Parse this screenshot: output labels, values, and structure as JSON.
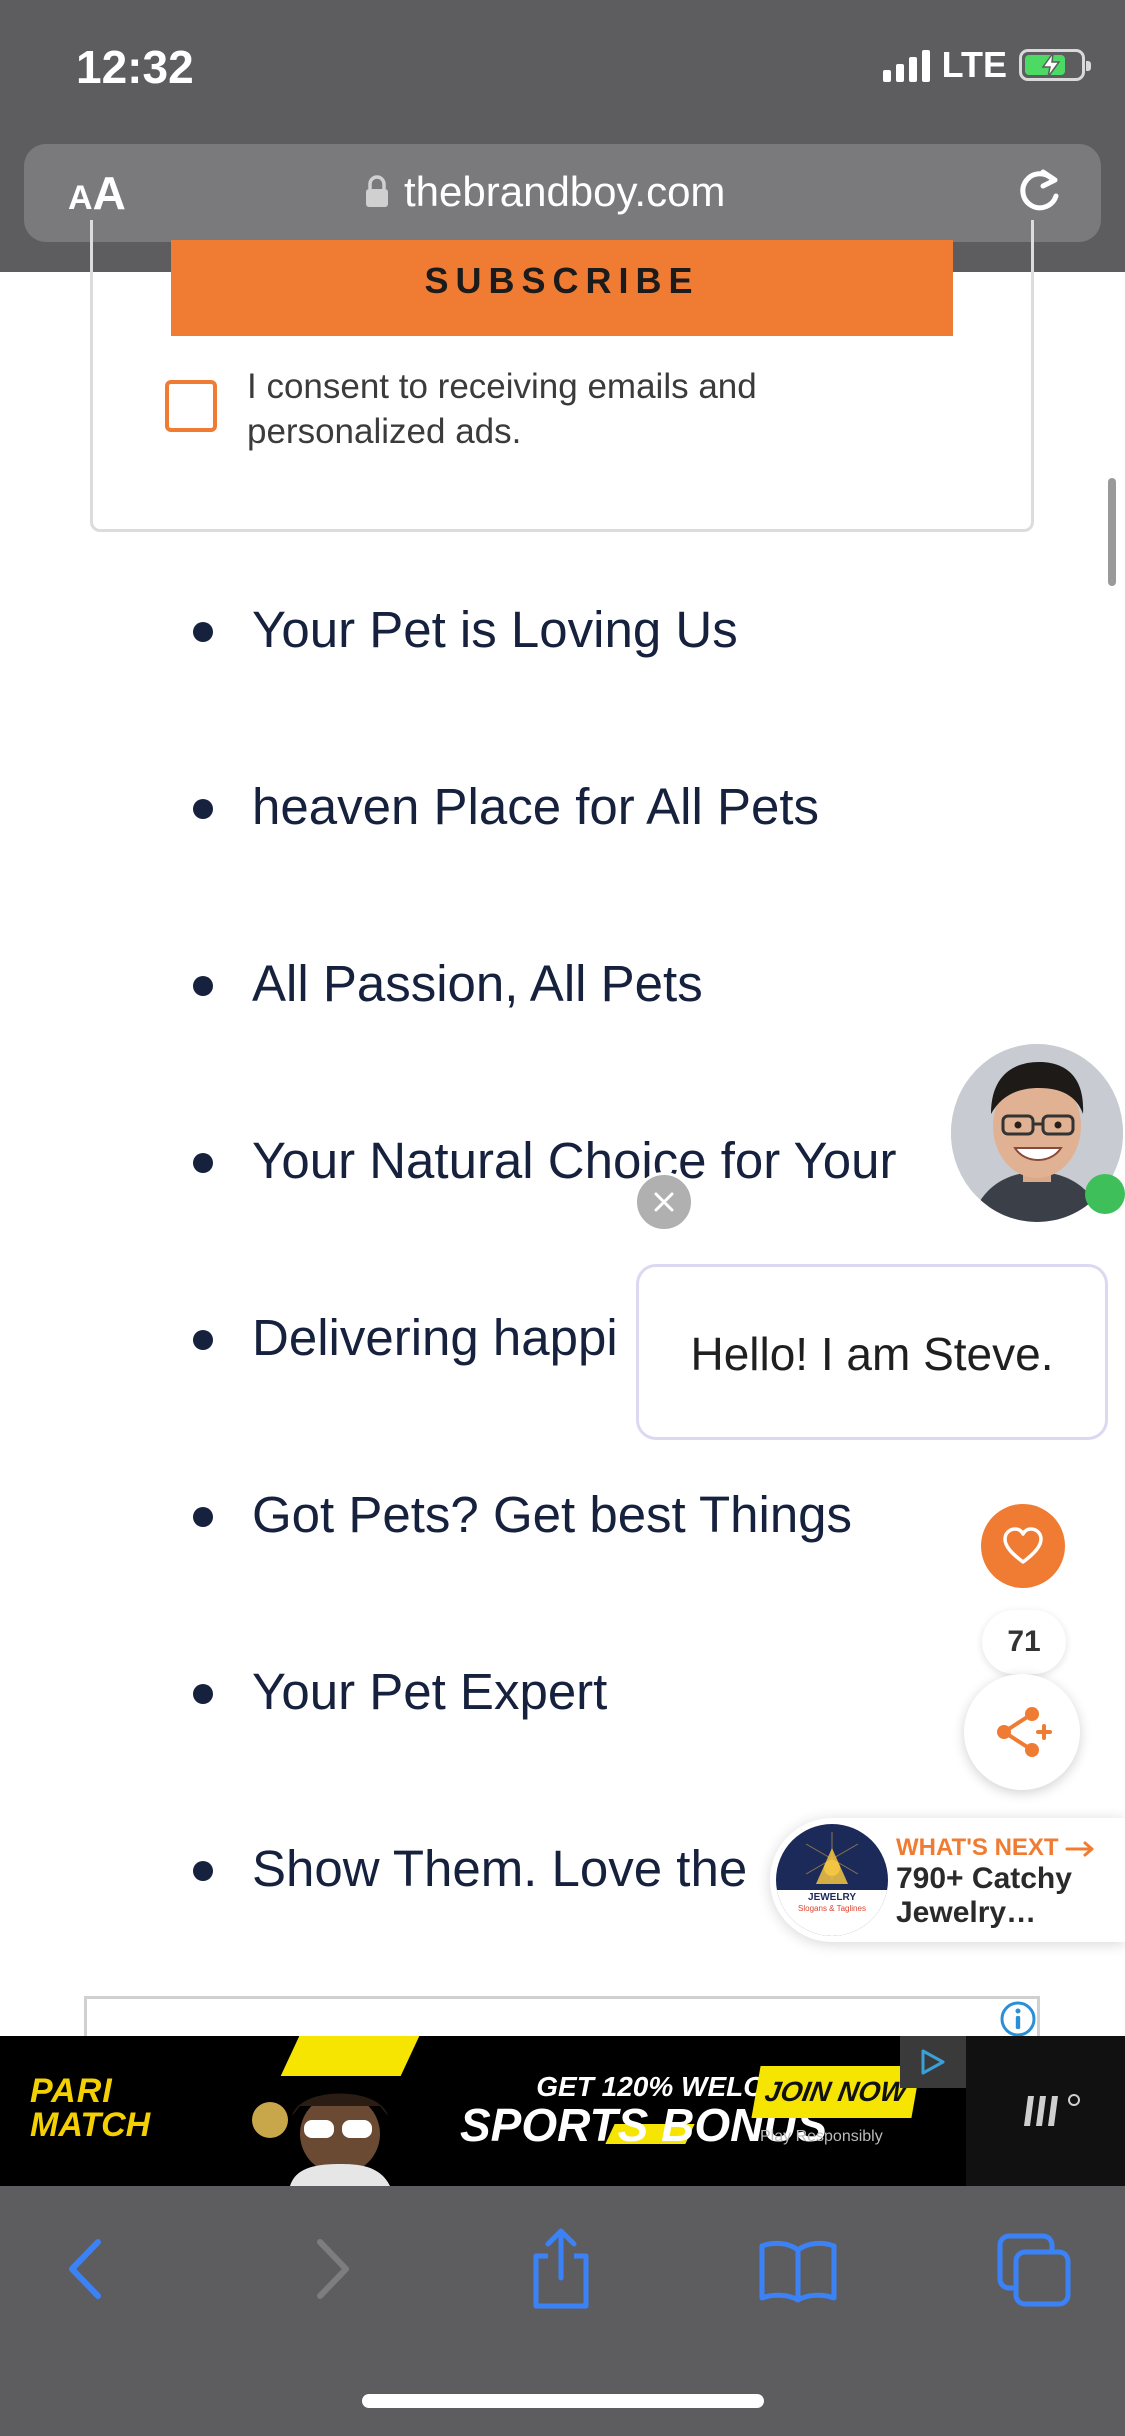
{
  "status_bar": {
    "time": "12:32",
    "network": "LTE"
  },
  "browser": {
    "text_size_small": "A",
    "text_size_big": "A",
    "url": "thebrandboy.com"
  },
  "subscribe": {
    "button_label": "SUBSCRIBE",
    "consent_text": "I consent to receiving emails and personalized ads."
  },
  "slogans": [
    "Your Pet is Loving Us",
    "heaven Place for All Pets",
    "All Passion, All Pets",
    "Your Natural Choice for Your",
    "Delivering happi",
    "Got Pets? Get best Things",
    "Your Pet Expert",
    "Show Them. Love the"
  ],
  "chat": {
    "greeting": "Hello! I am Steve."
  },
  "actions": {
    "like_count": "71"
  },
  "whats_next": {
    "label": "WHAT'S NEXT",
    "title": "790+ Catchy Jewelry…",
    "thumb_title": "JEWELRY",
    "thumb_subtitle": "Slogans & Taglines"
  },
  "banner_ad": {
    "brand_line1": "PARI",
    "brand_line2": "MATCH",
    "headline1": "GET 120% WELCOME",
    "headline2": "SPORTS BONUS",
    "cta": "JOIN NOW",
    "disclaimer": "Play Responsibly"
  },
  "colors": {
    "accent": "#f07b33",
    "text_dark": "#16213e",
    "chrome": "#5d5d5f",
    "toolbar_icon": "#3b82f6"
  }
}
